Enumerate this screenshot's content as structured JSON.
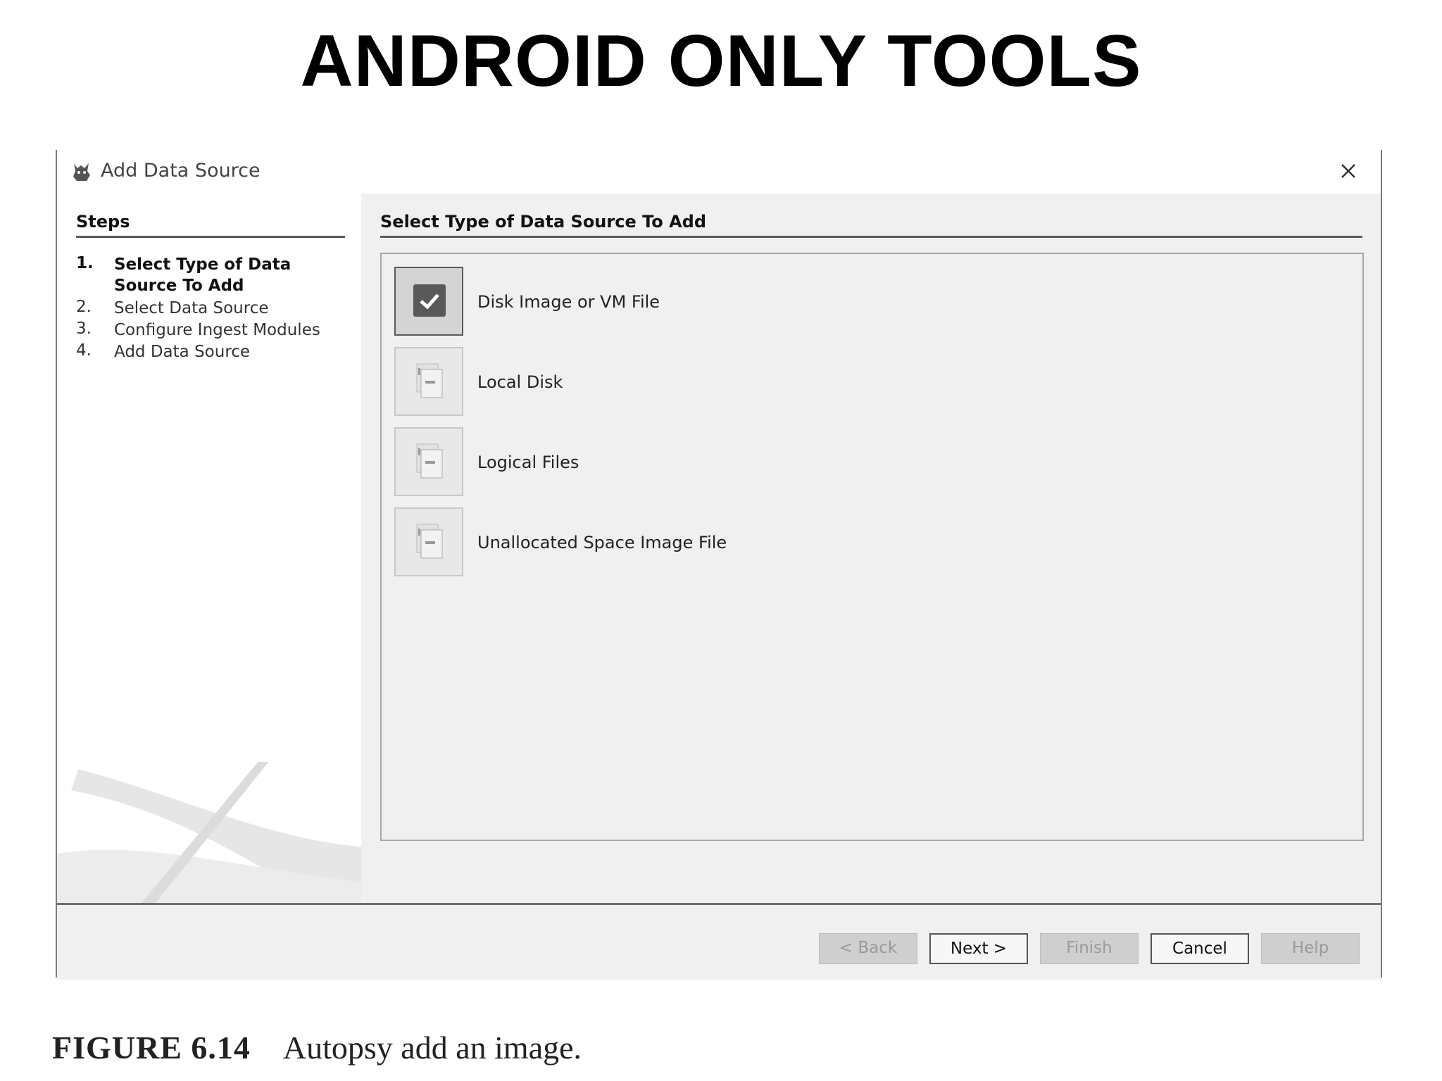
{
  "slide": {
    "title": "ANDROID ONLY TOOLS"
  },
  "dialog": {
    "title": "Add Data Source",
    "steps": {
      "heading": "Steps",
      "items": [
        {
          "num": "1.",
          "label": "Select Type of Data Source To Add",
          "active": true
        },
        {
          "num": "2.",
          "label": "Select Data Source",
          "active": false
        },
        {
          "num": "3.",
          "label": "Configure Ingest Modules",
          "active": false
        },
        {
          "num": "4.",
          "label": "Add Data Source",
          "active": false
        }
      ]
    },
    "main": {
      "heading": "Select Type of Data Source To Add",
      "options": [
        {
          "label": "Disk Image or VM File",
          "selected": true,
          "icon": "checkmark-icon"
        },
        {
          "label": "Local Disk",
          "selected": false,
          "icon": "document-icon"
        },
        {
          "label": "Logical Files",
          "selected": false,
          "icon": "document-icon"
        },
        {
          "label": "Unallocated Space Image File",
          "selected": false,
          "icon": "document-icon"
        }
      ]
    },
    "buttons": {
      "back": "< Back",
      "next": "Next >",
      "finish": "Finish",
      "cancel": "Cancel",
      "help": "Help"
    }
  },
  "caption": {
    "figure": "FIGURE 6.14",
    "text": "Autopsy add an image."
  }
}
